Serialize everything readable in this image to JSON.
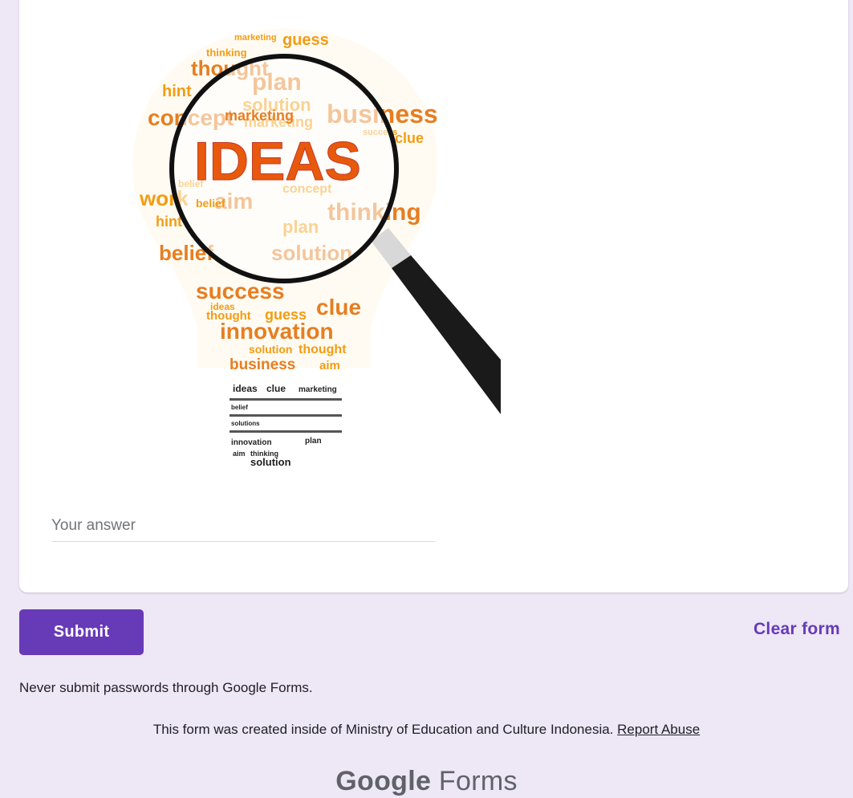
{
  "question": {
    "image": {
      "icon": "lightbulb-word-cloud-with-magnifying-glass",
      "words": {
        "highlight": "IDEAS",
        "cloud": [
          "marketing",
          "guess",
          "thinking",
          "thought",
          "plan",
          "hint",
          "solution",
          "business",
          "concept",
          "clue",
          "belief",
          "aim",
          "success",
          "innovation",
          "work",
          "ideas"
        ],
        "base": [
          "ideas",
          "clue",
          "marketing",
          "belief",
          "solutions",
          "innovation",
          "plan",
          "aim",
          "thinking",
          "solution"
        ]
      },
      "colors": {
        "cloud": "#f39c12",
        "cloud_dark": "#e67e22",
        "highlight": "#e8590c"
      }
    },
    "answer_placeholder": "Your answer"
  },
  "actions": {
    "submit_label": "Submit",
    "clear_label": "Clear form"
  },
  "warning": "Never submit passwords through Google Forms.",
  "footer": {
    "text": "This form was created inside of Ministry of Education and Culture Indonesia.",
    "report_label": "Report Abuse"
  },
  "brand": {
    "google": "Google",
    "forms": "Forms"
  },
  "colors": {
    "accent": "#673ab7",
    "background": "#ede7f6",
    "card": "#ffffff"
  }
}
